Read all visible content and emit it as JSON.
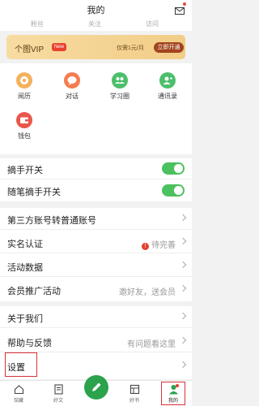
{
  "header": {
    "title": "我的",
    "stats": [
      "粉丝",
      "关注",
      "访问"
    ]
  },
  "vip": {
    "name": "个图VIP",
    "badge": "New",
    "price": "仅需1元/月",
    "button": "立即开通"
  },
  "features": [
    {
      "label": "阅历",
      "icon": "history-icon",
      "color": "#f4b25d"
    },
    {
      "label": "对话",
      "icon": "chat-icon",
      "color": "#f47c4f"
    },
    {
      "label": "学习圈",
      "icon": "study-circle-icon",
      "color": "#4cbf6b"
    },
    {
      "label": "通讯录",
      "icon": "contacts-icon",
      "color": "#4cbf6b"
    },
    {
      "label": "钱包",
      "icon": "wallet-icon",
      "color": "#e9574b"
    }
  ],
  "toggles": [
    {
      "label": "摘手开关",
      "on": true
    },
    {
      "label": "随笔摘手开关",
      "on": true
    }
  ],
  "settings_group1": [
    {
      "label": "第三方账号转普通账号",
      "value": ""
    },
    {
      "label": "实名认证",
      "value": "待完善",
      "warning": "!"
    },
    {
      "label": "活动数据",
      "value": ""
    },
    {
      "label": "会员推广活动",
      "value": "邀好友，送会员"
    }
  ],
  "settings_group2": [
    {
      "label": "关于我们",
      "value": ""
    },
    {
      "label": "帮助与反馈",
      "value": "有问题看这里"
    },
    {
      "label": "设置",
      "value": ""
    }
  ],
  "tabbar": [
    {
      "label": "馆藏",
      "icon": "home-icon"
    },
    {
      "label": "好文",
      "icon": "article-icon"
    },
    {
      "label": "",
      "icon": "pen-icon"
    },
    {
      "label": "好书",
      "icon": "book-icon"
    },
    {
      "label": "我的",
      "icon": "profile-icon"
    }
  ],
  "colors": {
    "accent": "#2ba24c",
    "toggle": "#4cc15f",
    "warning": "#e3402f",
    "highlight": "#d8303a"
  }
}
